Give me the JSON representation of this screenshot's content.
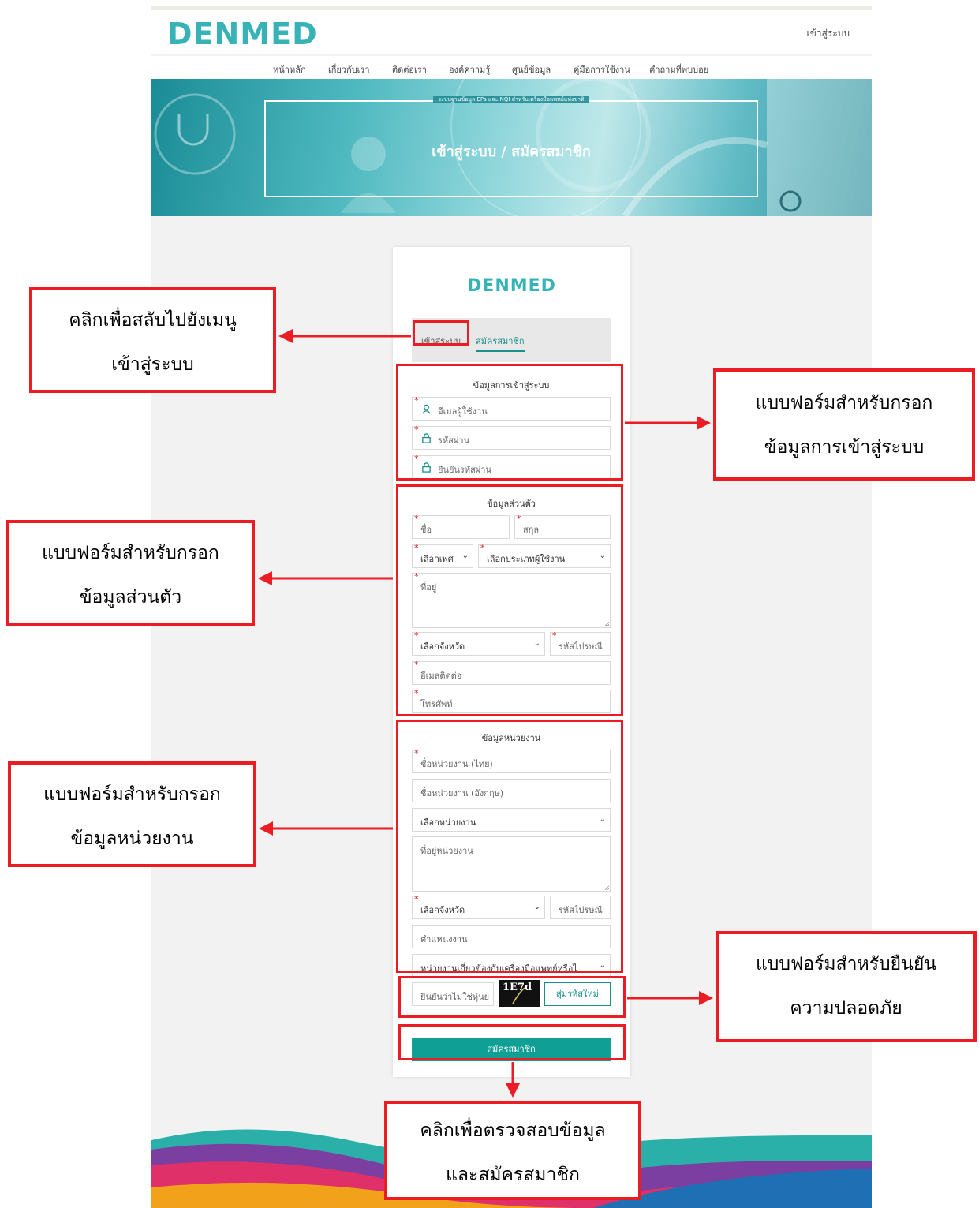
{
  "site": {
    "logo": "DENMED",
    "login_link": "เข้าสู่ระบบ",
    "nav": [
      "หน้าหลัก",
      "เกี่ยวกับเรา",
      "ติดต่อเรา",
      "องค์ความรู้",
      "ศูนย์ข้อมูล",
      "คู่มือการใช้งาน",
      "คำถามที่พบบ่อย"
    ]
  },
  "banner": {
    "small_text": "ระบบฐานข้อมูล EPs และ NQI สำหรับเครื่องมือแพทย์แห่งชาติ",
    "title": "เข้าสู่ระบบ / สมัครสมาชิก"
  },
  "card": {
    "logo": "DENMED",
    "tabs": {
      "login": "เข้าสู่ระบบ",
      "register": "สมัครสมาชิก"
    },
    "login_section": {
      "title": "ข้อมูลการเข้าสู่ระบบ",
      "email_placeholder": "อีเมลผู้ใช้งาน",
      "password_placeholder": "รหัสผ่าน",
      "confirm_password_placeholder": "ยืนยันรหัสผ่าน"
    },
    "personal_section": {
      "title": "ข้อมูลส่วนตัว",
      "first_name_placeholder": "ชื่อ",
      "last_name_placeholder": "สกุล",
      "gender_select": "เลือกเพศ",
      "user_type_select": "เลือกประเภทผู้ใช้งาน",
      "address_placeholder": "ที่อยู่",
      "province_select": "เลือกจังหวัด",
      "postcode_placeholder": "รหัสไปรษณี",
      "contact_email_placeholder": "อีเมลติดต่อ",
      "phone_placeholder": "โทรศัพท์"
    },
    "org_section": {
      "title": "ข้อมูลหน่วยงาน",
      "name_th_placeholder": "ชื่อหน่วยงาน (ไทย)",
      "name_en_placeholder": "ชื่อหน่วยงาน (อังกฤษ)",
      "org_select": "เลือกหน่วยงาน",
      "address_placeholder": "ที่อยู่หน่วยงาน",
      "province_select": "เลือกจังหวัด",
      "postcode_placeholder": "รหัสไปรษณี",
      "position_placeholder": "ตำแหน่งงาน",
      "related_select": "หน่วยงานเกี่ยวข้องกับเครื่องมือแพทย์หรือไ"
    },
    "captcha": {
      "placeholder": "ยืนยันว่าไม่ใช่หุ่นย",
      "code": "1E7d",
      "refresh_label": "สุ่มรหัสใหม่"
    },
    "submit_label": "สมัครสมาชิก"
  },
  "annotations": {
    "tab_switch": [
      "คลิกเพื่อสลับไปยังเมนู",
      "เข้าสู่ระบบ"
    ],
    "login_form": [
      "แบบฟอร์มสำหรับกรอก",
      "ข้อมูลการเข้าสู่ระบบ"
    ],
    "personal_form": [
      "แบบฟอร์มสำหรับกรอก",
      "ข้อมูลส่วนตัว"
    ],
    "org_form": [
      "แบบฟอร์มสำหรับกรอก",
      "ข้อมูลหน่วยงาน"
    ],
    "security_form": [
      "แบบฟอร์มสำหรับยืนยัน",
      "ความปลอดภัย"
    ],
    "submit": [
      "คลิกเพื่อตรวจสอบข้อมูล",
      "และสมัครสมาชิก"
    ]
  },
  "colors": {
    "brand_teal": "#37b3b8",
    "button_teal": "#109f95",
    "annotation_red": "#ec1c24",
    "required_star": "#e02020"
  },
  "icons": [
    "user-icon",
    "lock-icon",
    "chevron-down-icon"
  ]
}
